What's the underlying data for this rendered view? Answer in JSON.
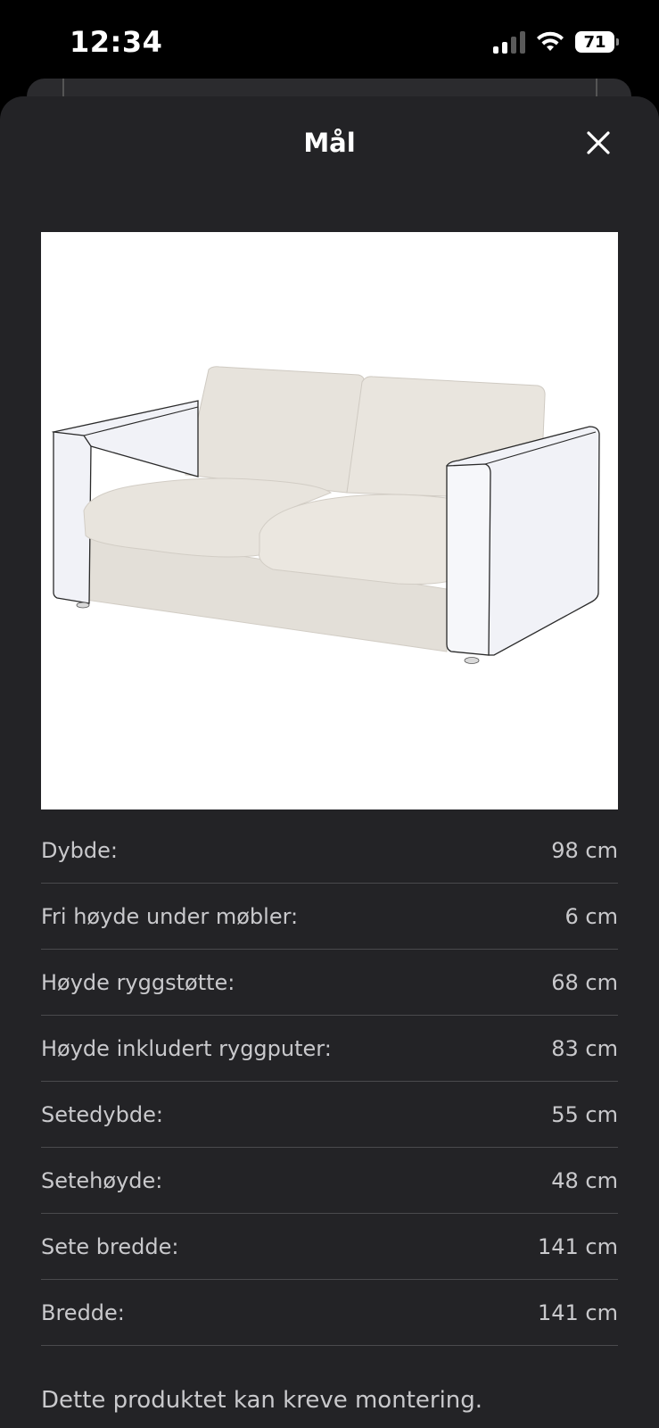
{
  "status_bar": {
    "time": "12:34",
    "battery": "71"
  },
  "sheet": {
    "title": "Mål",
    "close_icon": "close-icon"
  },
  "product": {
    "image_alt": "sofa-illustration"
  },
  "dimensions": [
    {
      "label": "Dybde:",
      "value": "98 cm"
    },
    {
      "label": "Fri høyde under møbler:",
      "value": "6 cm"
    },
    {
      "label": "Høyde ryggstøtte:",
      "value": "68 cm"
    },
    {
      "label": "Høyde inkludert ryggputer:",
      "value": "83 cm"
    },
    {
      "label": "Setedybde:",
      "value": "55 cm"
    },
    {
      "label": "Setehøyde:",
      "value": "48 cm"
    },
    {
      "label": "Sete bredde:",
      "value": "141 cm"
    },
    {
      "label": "Bredde:",
      "value": "141 cm"
    }
  ],
  "note": "Dette produktet kan kreve montering.",
  "colors": {
    "background": "#000000",
    "sheet": "#232326",
    "text": "#c9c9cc",
    "divider": "#4a4a4d",
    "upholstery": "#e7e3dc",
    "frame_cover": "#f1f2f7"
  }
}
